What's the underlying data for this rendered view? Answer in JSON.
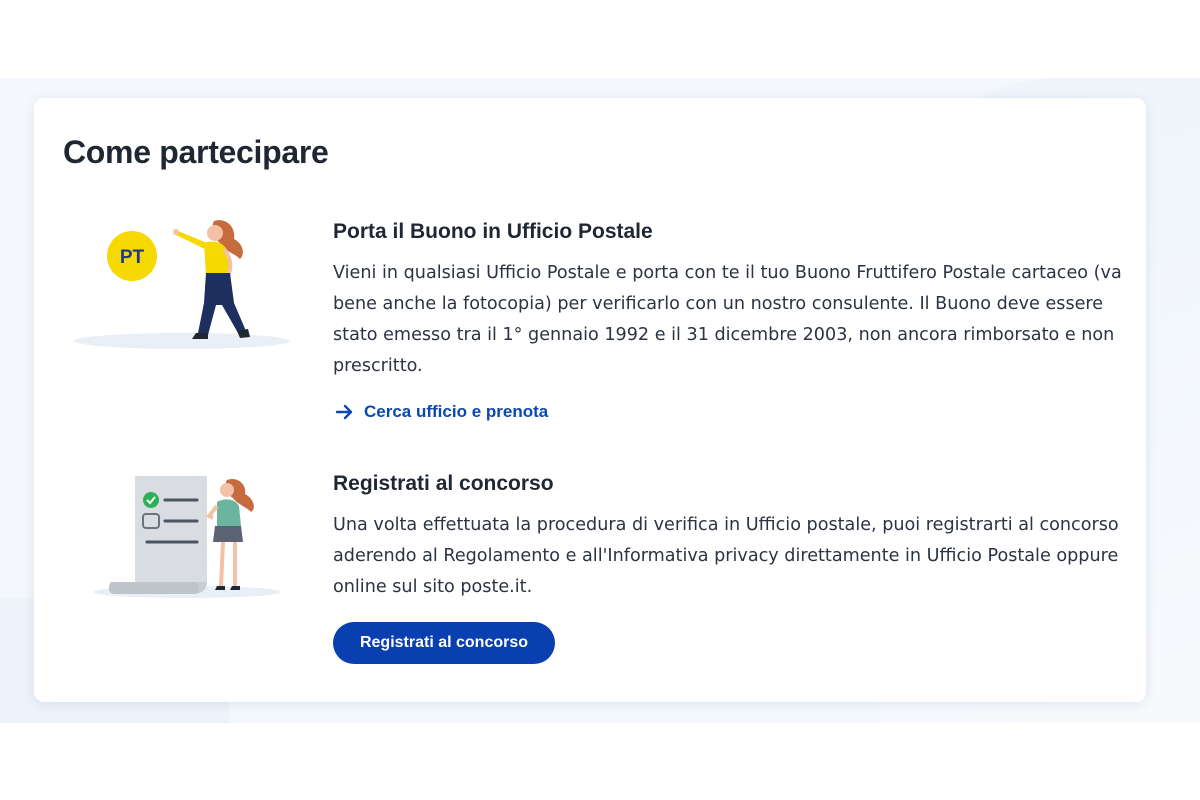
{
  "section": {
    "title": "Come partecipare"
  },
  "steps": [
    {
      "title": "Porta il Buono in Ufficio Postale",
      "text": "Vieni in qualsiasi Ufficio Postale e porta con te il tuo Buono Fruttifero Postale cartaceo (va bene anche la fotocopia) per verificarlo con un nostro consulente. Il Buono deve essere stato emesso tra il 1° gennaio 1992 e il 31 dicembre 2003, non ancora rimborsato e non prescritto.",
      "link_label": "Cerca ufficio e prenota",
      "illustration_badge": "PT"
    },
    {
      "title": "Registrati al concorso",
      "text": "Una volta effettuata la procedura di verifica in Ufficio postale, puoi registrarti al concorso aderendo al Regolamento e all'Informativa privacy direttamente in Ufficio Postale oppure online sul sito poste.it.",
      "button_label": "Registrati al concorso"
    }
  ],
  "icons": {
    "link_arrow": "arrow-right-icon",
    "badge_logo": "pt-logo",
    "illustration_1": "woman-pointing-illustration",
    "illustration_2": "woman-checklist-illustration"
  },
  "colors": {
    "accent": "#0a3fb0",
    "link": "#0a48b4",
    "logo_yellow": "#f6d900",
    "page_bg": "#f4f8fc"
  }
}
